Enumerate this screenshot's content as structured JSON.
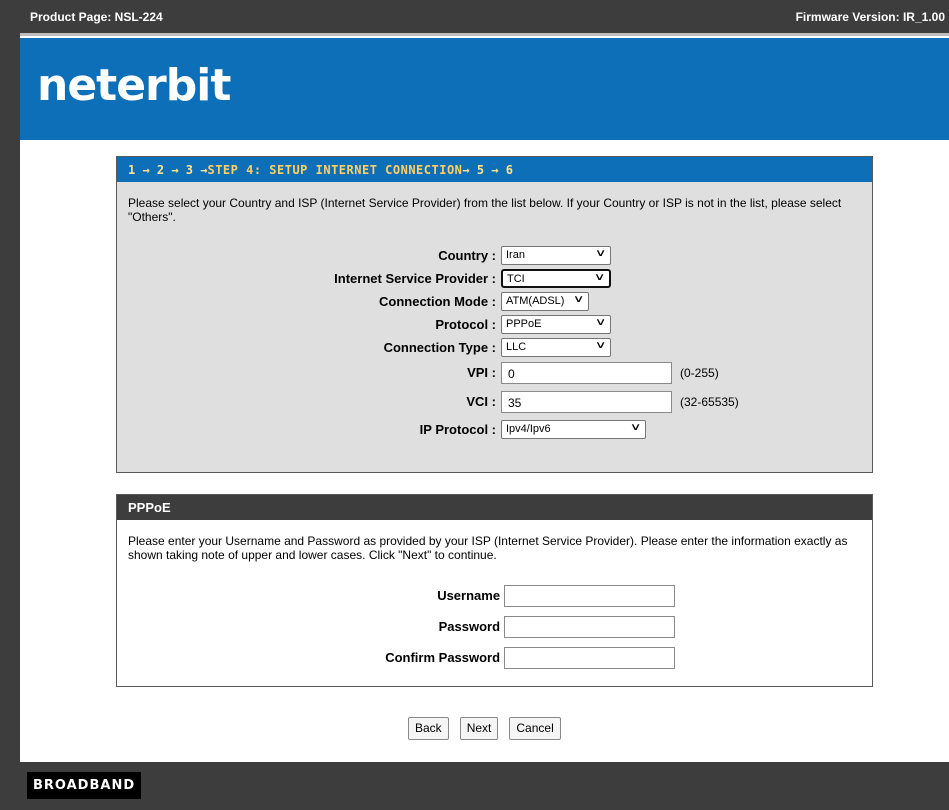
{
  "topbar": {
    "product": "Product Page: NSL-224",
    "firmware": "Firmware Version: IR_1.00"
  },
  "brand": {
    "logo": "neterbit"
  },
  "wizard": {
    "steps_before": "1 → 2 → 3 → ",
    "current_step": "STEP 4: SETUP INTERNET CONNECTION",
    "steps_after": " → 5 → 6",
    "description": "Please select your Country and ISP (Internet Service Provider) from the list below. If your Country or ISP is not in the list, please select \"Others\".",
    "fields": {
      "country": {
        "label": "Country :",
        "value": "Iran"
      },
      "isp": {
        "label": "Internet Service Provider :",
        "value": "TCI"
      },
      "connection_mode": {
        "label": "Connection Mode :",
        "value": "ATM(ADSL)"
      },
      "protocol": {
        "label": "Protocol :",
        "value": "PPPoE"
      },
      "connection_type": {
        "label": "Connection Type :",
        "value": "LLC"
      },
      "vpi": {
        "label": "VPI :",
        "value": "0",
        "hint": "(0-255)"
      },
      "vci": {
        "label": "VCI :",
        "value": "35",
        "hint": "(32-65535)"
      },
      "ip_protocol": {
        "label": "IP Protocol :",
        "value": "Ipv4/Ipv6"
      }
    }
  },
  "pppoe": {
    "title": "PPPoE",
    "description": "Please enter your Username and Password as provided by your ISP (Internet Service Provider). Please enter the information exactly as shown taking note of upper and lower cases. Click \"Next\" to continue.",
    "fields": {
      "username": {
        "label": "Username :",
        "value": ""
      },
      "password": {
        "label": "Password :",
        "value": ""
      },
      "confirm_password": {
        "label": "Confirm Password :",
        "value": ""
      }
    }
  },
  "buttons": {
    "back": "Back",
    "next": "Next",
    "cancel": "Cancel"
  },
  "footer": {
    "badge": "BROADBAND"
  },
  "colors": {
    "brand_blue": "#0d6fb8",
    "dark_bar": "#3d3d3d",
    "panel_gray": "#dfdfdf",
    "step_highlight": "#ffcf66"
  }
}
